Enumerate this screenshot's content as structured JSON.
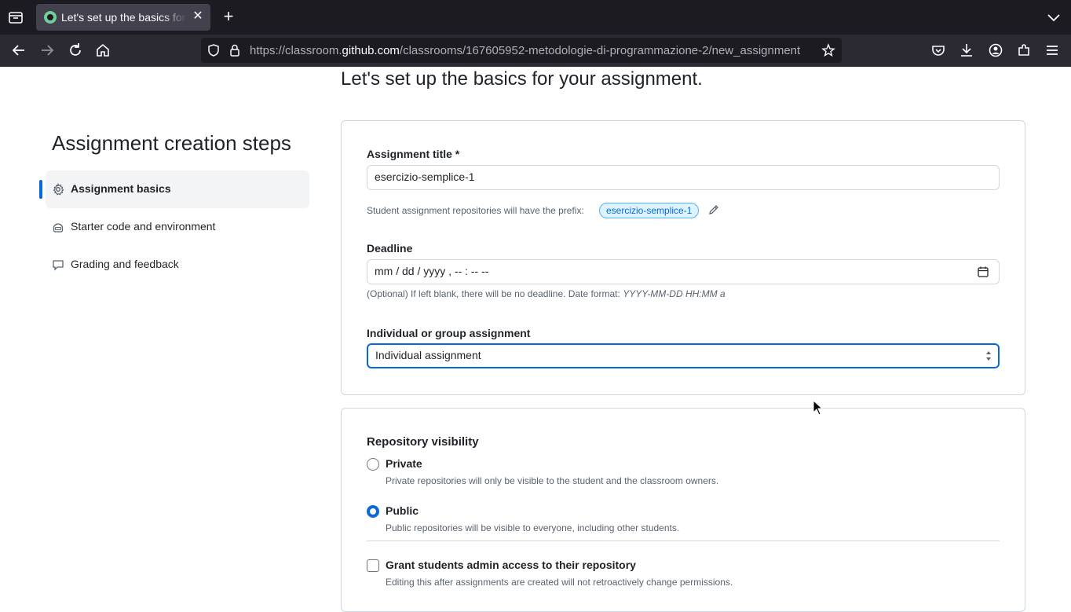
{
  "browser": {
    "tab_title": "Let's set up the basics for your assignment",
    "tab_close": "✕",
    "new_tab": "+",
    "url_prefix": "https://classroom.",
    "url_domain": "github.com",
    "url_path": "/classrooms/167605952-metodologie-di-programmazione-2/new_assignment"
  },
  "page": {
    "heading": "Let's set up the basics for your assignment."
  },
  "sidebar": {
    "title": "Assignment creation steps",
    "steps": [
      {
        "label": "Assignment basics",
        "icon": "gear-icon",
        "active": true
      },
      {
        "label": "Starter code and environment",
        "icon": "copilot-icon",
        "active": false
      },
      {
        "label": "Grading and feedback",
        "icon": "comment-icon",
        "active": false
      }
    ]
  },
  "basics_card": {
    "title_label": "Assignment title *",
    "title_value": "esercizio-semplice-1",
    "prefix_hint": "Student assignment repositories will have the prefix:",
    "prefix_badge": "esercizio-semplice-1",
    "deadline_label": "Deadline",
    "deadline_placeholder": "mm / dd / yyyy ,  -- : --   --",
    "deadline_hint": "(Optional) If left blank, there will be no deadline. Date format:",
    "deadline_format": "YYYY-MM-DD HH:MM a",
    "type_label": "Individual or group assignment",
    "type_value": "Individual assignment"
  },
  "visibility_card": {
    "label": "Repository visibility",
    "options": [
      {
        "label": "Private",
        "desc": "Private repositories will only be visible to the student and the classroom owners.",
        "checked": false
      },
      {
        "label": "Public",
        "desc": "Public repositories will be visible to everyone, including other students.",
        "checked": true
      }
    ],
    "admin_label": "Grant students admin access to their repository",
    "admin_desc": "Editing this after assignments are created will not retroactively change permissions."
  }
}
